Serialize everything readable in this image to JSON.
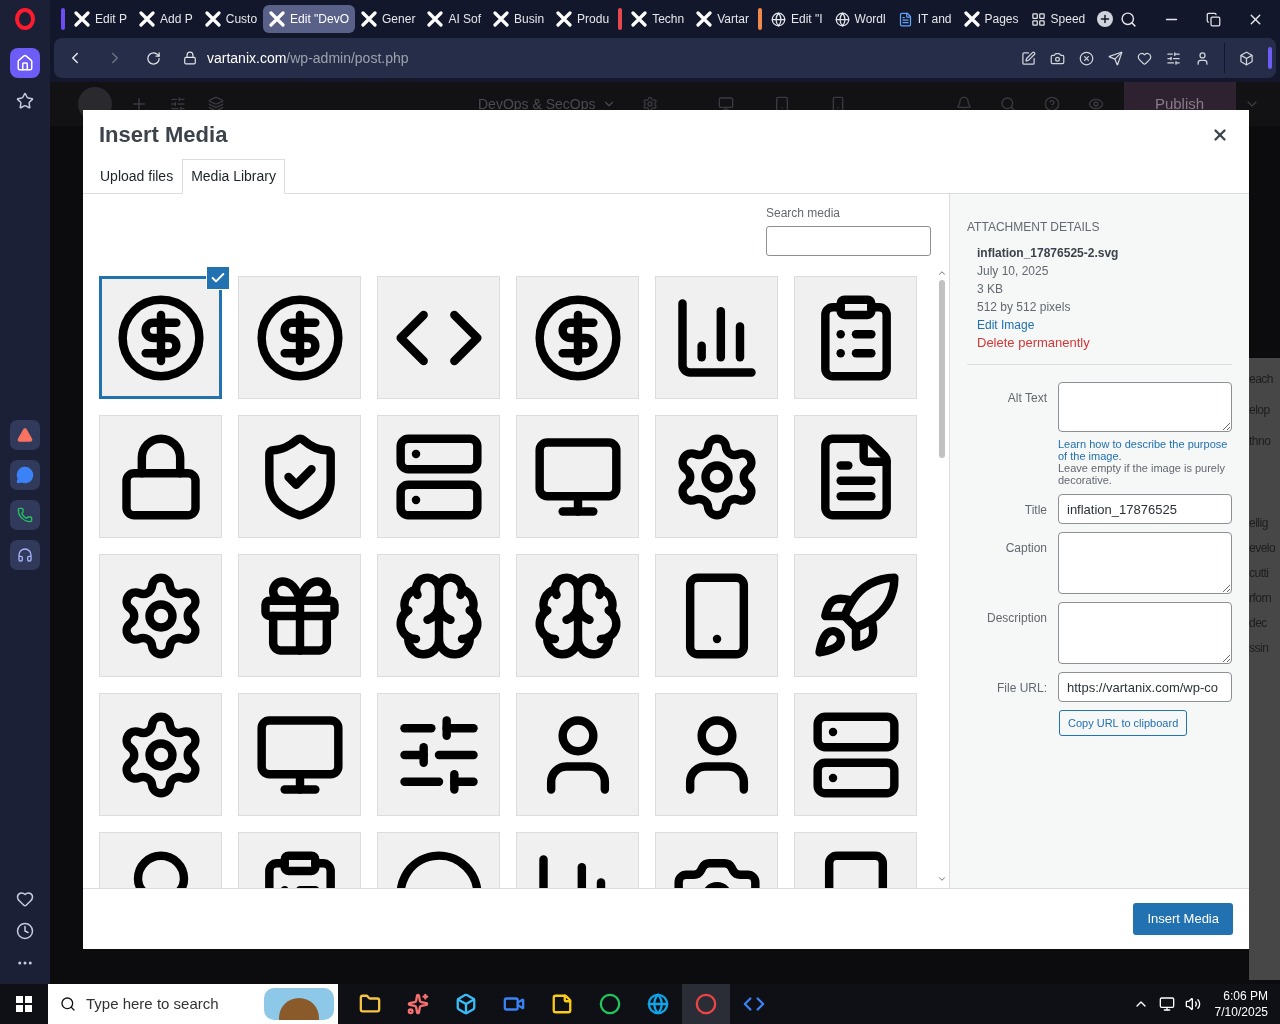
{
  "browser": {
    "tabs": [
      {
        "title": "Edit P",
        "kind": "elementor",
        "selected": false,
        "color": "#6c4cf5"
      },
      {
        "title": "Add P",
        "kind": "elementor",
        "selected": false
      },
      {
        "title": "Custo",
        "kind": "elementor",
        "selected": false
      },
      {
        "title": "Edit \"DevO",
        "kind": "elementor",
        "selected": true
      },
      {
        "title": "Gener",
        "kind": "elementor",
        "selected": false
      },
      {
        "title": "AI Sof",
        "kind": "elementor",
        "selected": false
      },
      {
        "title": "Busin",
        "kind": "elementor",
        "selected": false
      },
      {
        "title": "Produ",
        "kind": "elementor",
        "selected": false
      },
      {
        "title": "Techn",
        "kind": "elementor",
        "selected": false,
        "color": "#e5484d"
      },
      {
        "title": "Vartar",
        "kind": "elementor",
        "selected": false
      },
      {
        "title": "Edit \"I",
        "kind": "globe",
        "selected": false,
        "color": "#f08a4b"
      },
      {
        "title": "Wordl",
        "kind": "globe",
        "selected": false
      },
      {
        "title": "IT and",
        "kind": "document",
        "selected": false
      },
      {
        "title": "Pages",
        "kind": "elementor",
        "selected": false
      },
      {
        "title": "Speed",
        "kind": "grid",
        "selected": false
      }
    ],
    "address": {
      "host": "vartanix.com",
      "path": "/wp-admin/post.php"
    }
  },
  "background_page": {
    "document_title": "DevOps & SecOps",
    "publish_button": "Publish",
    "text_blocks": [
      [
        "each",
        "elop",
        "thno"
      ],
      [
        "ellig",
        "evelo",
        "cutti",
        "rforn",
        "dec",
        "ssin"
      ]
    ]
  },
  "modal": {
    "title": "Insert Media",
    "tabs": [
      {
        "label": "Upload files",
        "selected": false
      },
      {
        "label": "Media Library",
        "selected": true
      }
    ],
    "search": {
      "label": "Search media"
    },
    "media_items": [
      {
        "selected": true
      },
      {
        "selected": false
      },
      {
        "selected": false
      },
      {
        "selected": false
      },
      {
        "selected": false
      },
      {
        "selected": false
      },
      {
        "selected": false
      },
      {
        "selected": false
      },
      {
        "selected": false
      },
      {
        "selected": false
      },
      {
        "selected": false
      },
      {
        "selected": false
      },
      {
        "selected": false
      },
      {
        "selected": false
      },
      {
        "selected": false
      },
      {
        "selected": false
      },
      {
        "selected": false
      },
      {
        "selected": false
      },
      {
        "selected": false
      },
      {
        "selected": false
      },
      {
        "selected": false
      },
      {
        "selected": false
      },
      {
        "selected": false
      },
      {
        "selected": false
      },
      {
        "selected": false
      },
      {
        "selected": false
      },
      {
        "selected": false
      },
      {
        "selected": false
      },
      {
        "selected": false
      },
      {
        "selected": false
      }
    ],
    "details": {
      "heading": "ATTACHMENT DETAILS",
      "filename": "inflation_17876525-2.svg",
      "date": "July 10, 2025",
      "size": "3 KB",
      "dimensions": "512 by 512 pixels",
      "edit_link": "Edit Image",
      "delete_link": "Delete permanently",
      "fields": [
        {
          "label": "Alt Text",
          "kind": "textarea",
          "help_link": "Learn how to describe the purpose of the image.",
          "help_text": "Leave empty if the image is purely decorative."
        },
        {
          "label": "Title",
          "kind": "input",
          "value": "inflation_17876525"
        },
        {
          "label": "Caption",
          "kind": "textarea"
        },
        {
          "label": "Description",
          "kind": "textarea"
        },
        {
          "label": "File URL:",
          "kind": "readonly",
          "value": "https://vartanix.com/wp-co"
        }
      ],
      "copy_button": "Copy URL to clipboard"
    },
    "insert_button": "Insert Media"
  },
  "taskbar": {
    "search_placeholder": "Type here to search",
    "time": "6:06 PM",
    "date": "7/10/2025"
  }
}
